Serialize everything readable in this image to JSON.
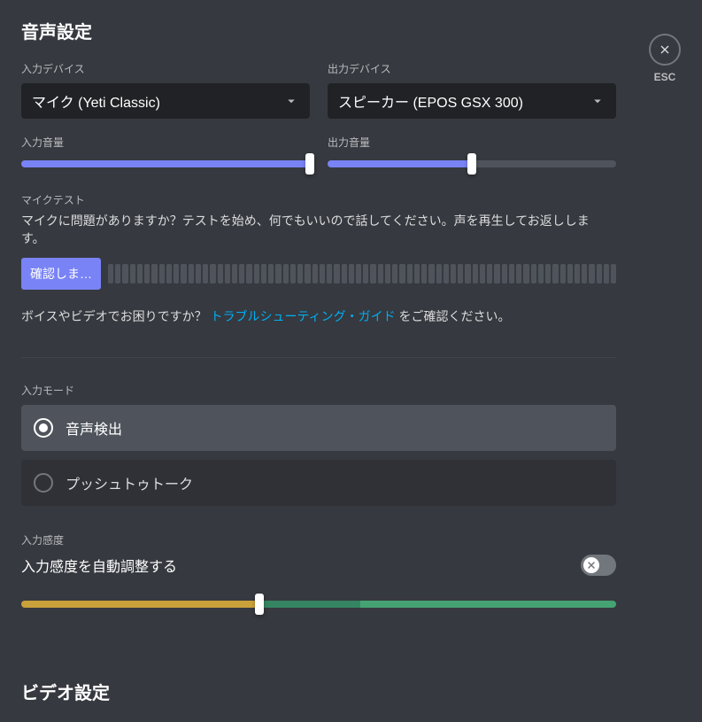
{
  "close": {
    "label": "ESC"
  },
  "heading": "音声設定",
  "input_device": {
    "label": "入力デバイス",
    "value": "マイク (Yeti Classic)"
  },
  "output_device": {
    "label": "出力デバイス",
    "value": "スピーカー (EPOS GSX 300)"
  },
  "input_volume": {
    "label": "入力音量",
    "percent": 100
  },
  "output_volume": {
    "label": "出力音量",
    "percent": 50
  },
  "mic_test": {
    "title": "マイクテスト",
    "description": "マイクに問題がありますか？テストを始め、何でもいいので話してください。声を再生してお返ししま す。",
    "button": "確認しまし..."
  },
  "troubleshoot": {
    "prefix": "ボイスやビデオでお困りですか？ ",
    "link": "トラブルシューティング・ガイド",
    "suffix": " をご確認ください。"
  },
  "input_mode": {
    "label": "入力モード",
    "options": [
      {
        "label": "音声検出",
        "selected": true
      },
      {
        "label": "プッシュトゥトーク",
        "selected": false
      }
    ]
  },
  "sensitivity": {
    "label": "入力感度",
    "auto_label": "入力感度を自動調整する",
    "auto_enabled": false,
    "threshold_percent": 40,
    "split2_percent": 57
  },
  "video_heading": "ビデオ設定"
}
